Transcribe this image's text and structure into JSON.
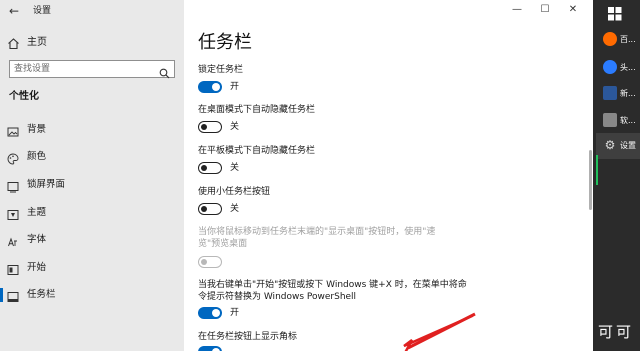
{
  "window": {
    "title": "设置",
    "buttons": [
      "—",
      "☐",
      "✕"
    ]
  },
  "nav": {
    "home": "主页",
    "search_placeholder": "查找设置",
    "section": "个性化",
    "items": [
      {
        "label": "背景",
        "icon": "image-icon"
      },
      {
        "label": "颜色",
        "icon": "palette-icon"
      },
      {
        "label": "锁屏界面",
        "icon": "lockscreen-icon"
      },
      {
        "label": "主题",
        "icon": "theme-icon"
      },
      {
        "label": "字体",
        "icon": "font-icon"
      },
      {
        "label": "开始",
        "icon": "start-icon"
      },
      {
        "label": "任务栏",
        "icon": "taskbar-icon",
        "active": true
      }
    ]
  },
  "content": {
    "title": "任务栏",
    "settings": [
      {
        "label": "锁定任务栏",
        "state": "开",
        "on": true
      },
      {
        "label": "在桌面模式下自动隐藏任务栏",
        "state": "关",
        "on": false
      },
      {
        "label": "在平板模式下自动隐藏任务栏",
        "state": "关",
        "on": false
      },
      {
        "label": "使用小任务栏按钮",
        "state": "关",
        "on": false
      },
      {
        "label": "当你将鼠标移动到任务栏末端的\"显示桌面\"按钮时，使用\"速览\"预览桌面",
        "state": "",
        "on": false,
        "disabled": true
      },
      {
        "label": "当我右键单击\"开始\"按钮或按下 Windows 键+X 时，在菜单中将命令提示符替换为 Windows PowerShell",
        "state": "开",
        "on": true
      },
      {
        "label": "在任务栏按钮上显示角标",
        "state": "",
        "on": true
      }
    ]
  },
  "taskbar": {
    "items": [
      {
        "label": "百...",
        "color": "#ff6a00"
      },
      {
        "label": "头...",
        "color": "#2b7cff"
      },
      {
        "label": "新...",
        "color": "#2b579a"
      },
      {
        "label": "软...",
        "color": "#888888"
      },
      {
        "label": "设置",
        "color": "#cccccc"
      }
    ],
    "watermark": "可可"
  },
  "colors": {
    "accent": "#0067c0",
    "nav_bg": "#e9e9e9",
    "taskbar_bg": "#2b2b2b",
    "arrow": "#e02020"
  }
}
